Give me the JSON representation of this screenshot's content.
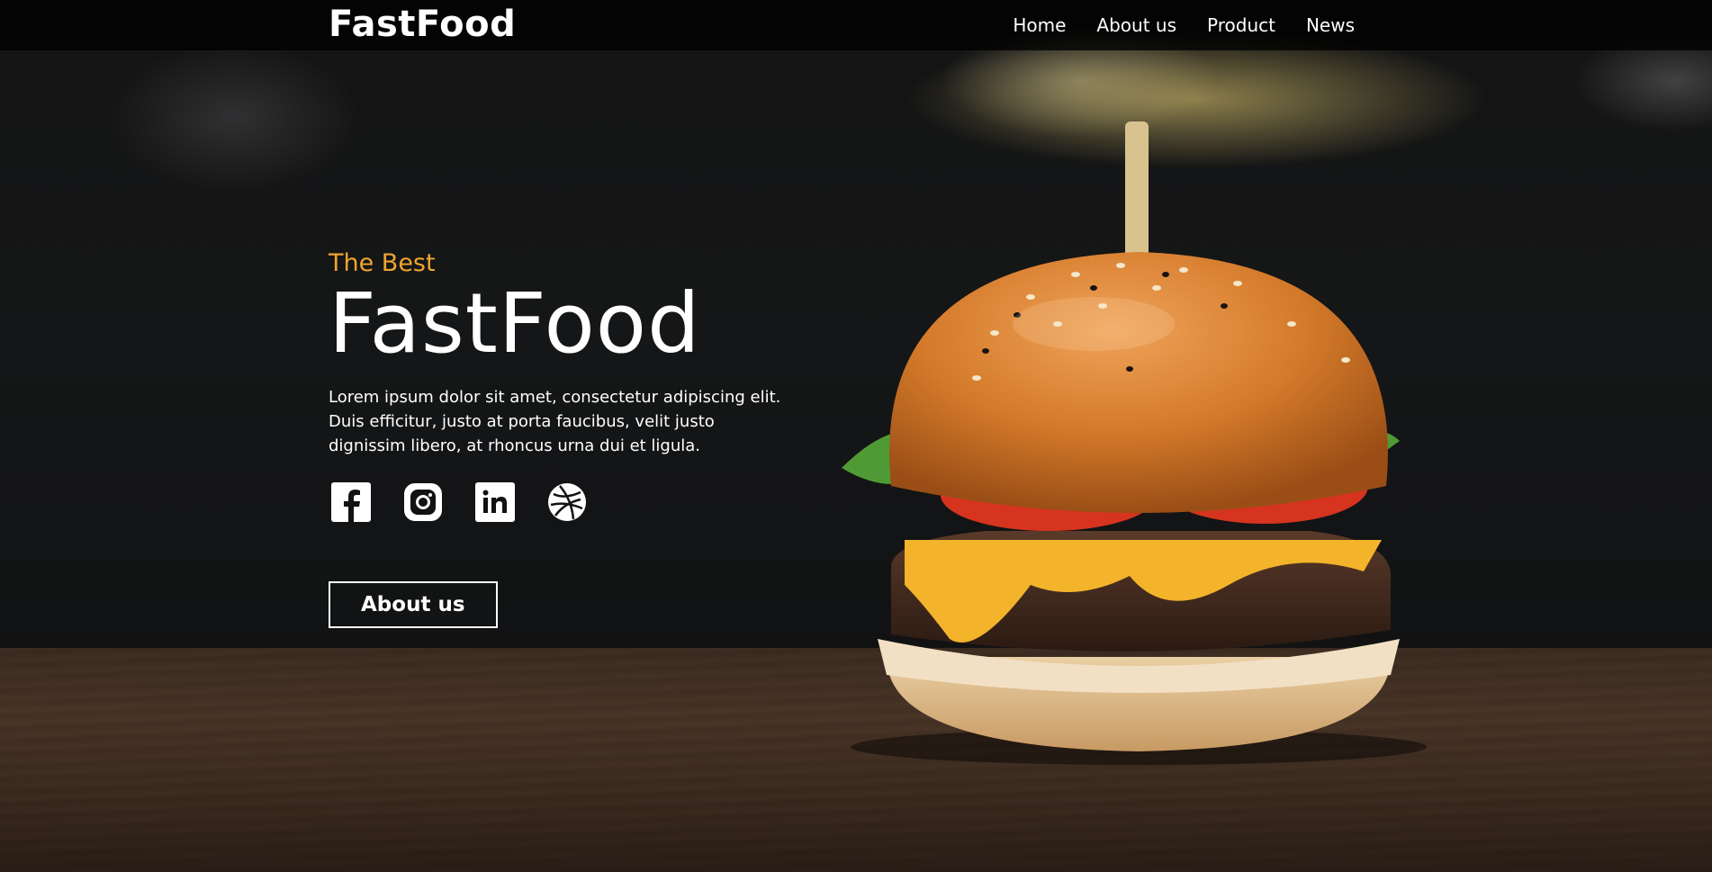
{
  "header": {
    "brand": "FastFood",
    "nav": [
      "Home",
      "About us",
      "Product",
      "News"
    ]
  },
  "hero": {
    "eyebrow": "The Best",
    "title": "FastFood",
    "description": "Lorem ipsum dolor sit amet, consectetur adipiscing elit. Duis efficitur, justo at porta faucibus, velit justo dignissim libero, at rhoncus urna dui et ligula.",
    "cta": "About us",
    "socials": [
      "facebook-icon",
      "instagram-icon",
      "linkedin-icon",
      "dribbble-icon"
    ]
  },
  "colors": {
    "accent": "#f0a530",
    "text": "#ffffff",
    "topbar": "#000000"
  }
}
